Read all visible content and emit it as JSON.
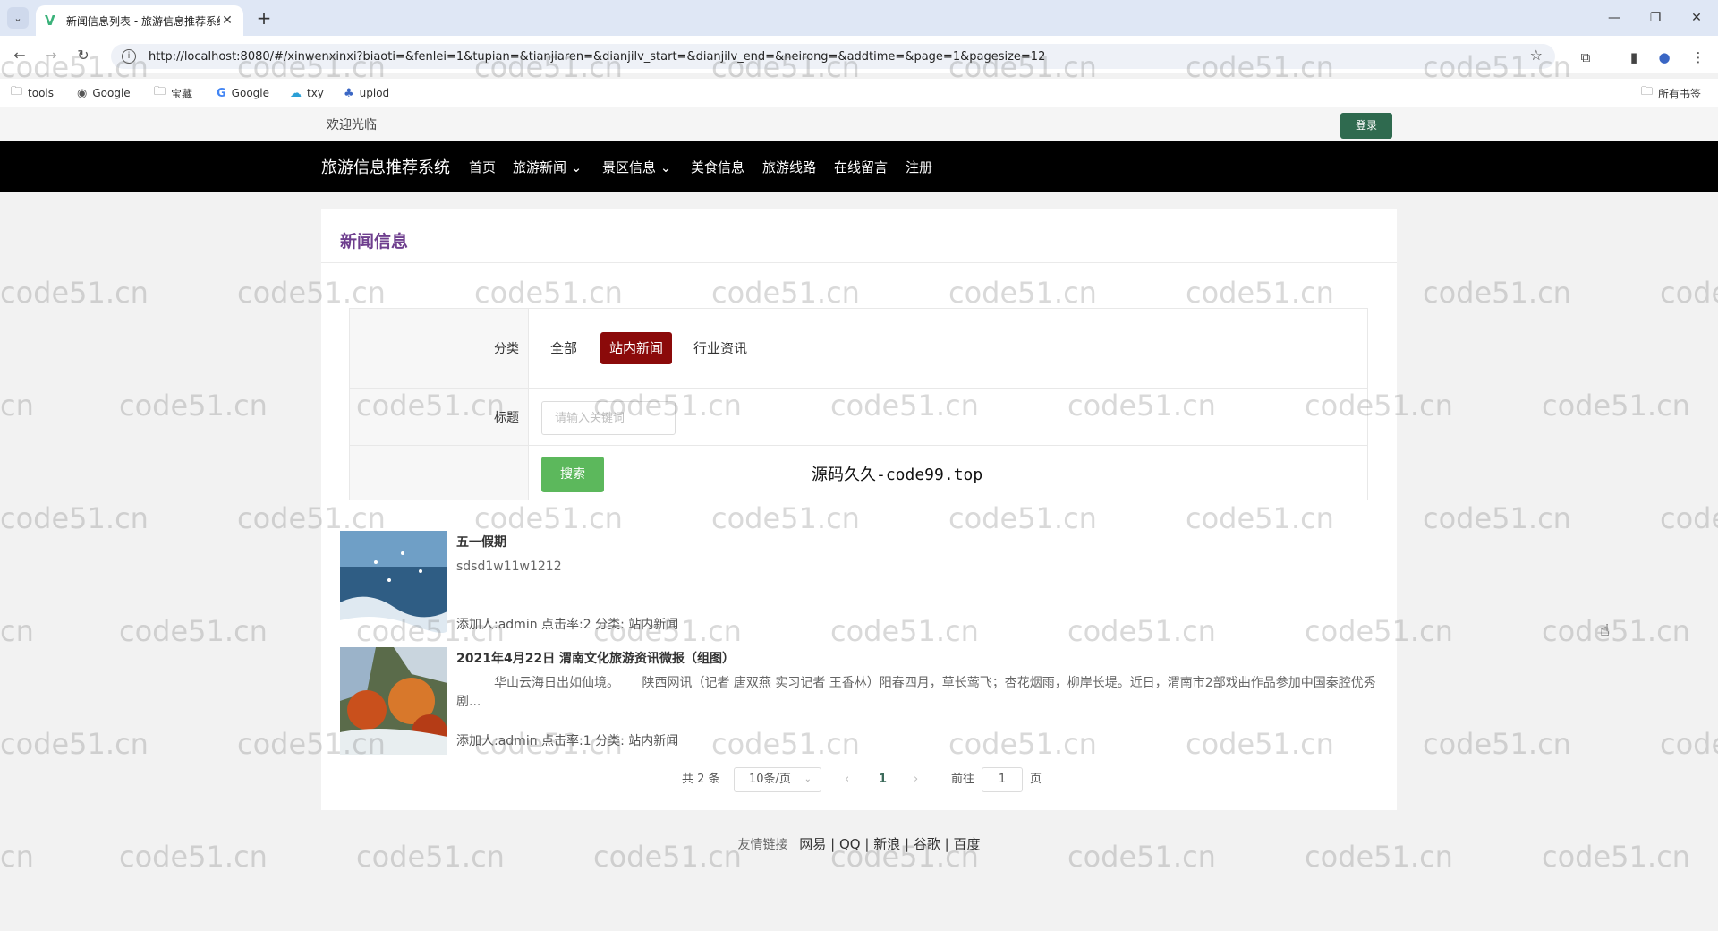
{
  "browser": {
    "tab_title": "新闻信息列表 - 旅游信息推荐系统",
    "url": "http://localhost:8080/#/xinwenxinxi?biaoti=&fenlei=1&tupian=&tianjiaren=&dianjilv_start=&dianjilv_end=&neirong=&addtime=&page=1&pagesize=12",
    "bookmarks": [
      "tools",
      "Google",
      "宝藏",
      "Google",
      "txy",
      "uplod"
    ],
    "all_bookmarks": "所有书签"
  },
  "top": {
    "welcome": "欢迎光临",
    "login": "登录"
  },
  "nav": {
    "brand": "旅游信息推荐系统",
    "items": [
      "首页",
      "旅游新闻",
      "景区信息",
      "美食信息",
      "旅游线路",
      "在线留言",
      "注册"
    ]
  },
  "card": {
    "title": "新闻信息"
  },
  "filter": {
    "category_label": "分类",
    "categories": [
      "全部",
      "站内新闻",
      "行业资讯"
    ],
    "title_label": "标题",
    "keyword_placeholder": "请输入关键词",
    "search_label": "搜索",
    "overlay_text": "源码久久-code99.top"
  },
  "news": [
    {
      "title": "五一假期",
      "summary": "sdsd1w11w1212",
      "meta": "添加人:admin  点击率:2  分类: 站内新闻"
    },
    {
      "title": "2021年4月22日 渭南文化旅游资讯微报（组图）",
      "summary": "　　　华山云海日出如仙境。　　 陕西网讯（记者 唐双燕 实习记者 王香林）阳春四月，草长莺飞；杏花烟雨，柳岸长堤。近日，渭南市2部戏曲作品参加中国秦腔优秀剧...",
      "meta": "添加人:admin  点击率:1  分类: 站内新闻"
    }
  ],
  "pager": {
    "total": "共 2 条",
    "page_size": "10条/页",
    "current": "1",
    "goto_prefix": "前往",
    "goto_value": "1",
    "goto_suffix": "页"
  },
  "footer": {
    "label": "友情链接",
    "links": [
      "网易",
      "QQ",
      "新浪",
      "谷歌",
      "百度"
    ],
    "sep": "|"
  },
  "watermark": "code51.cn"
}
